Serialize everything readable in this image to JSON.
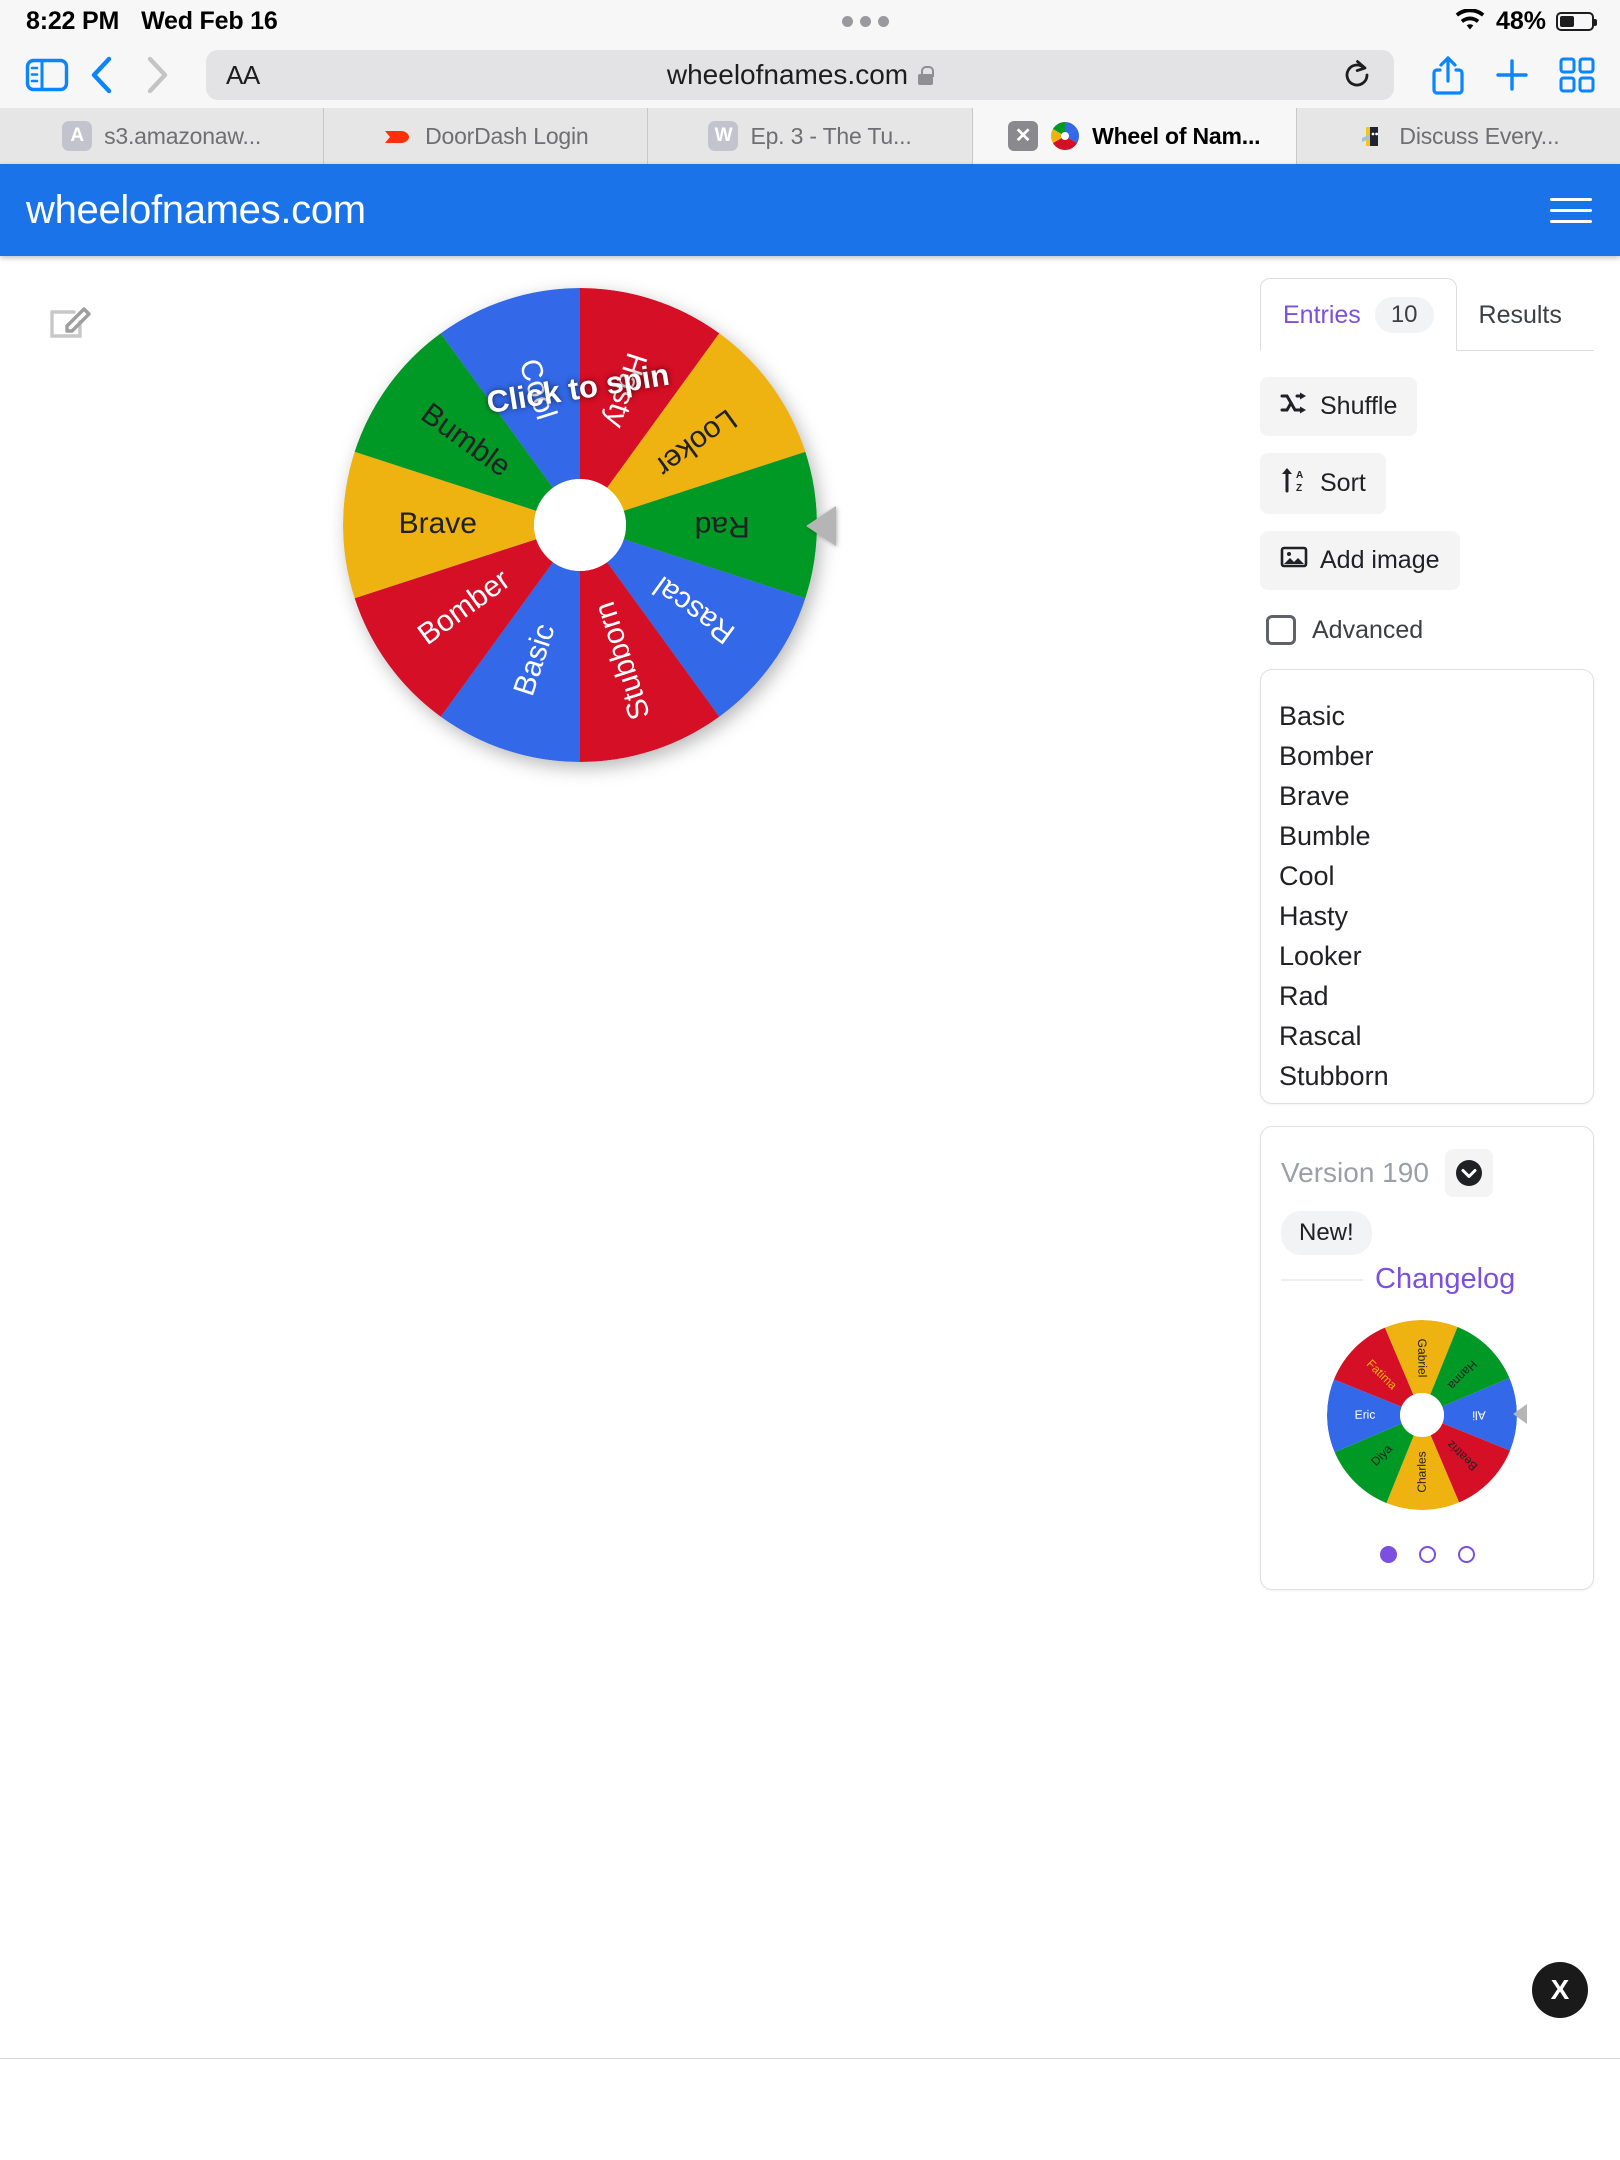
{
  "status_bar": {
    "time": "8:22 PM",
    "date": "Wed Feb 16",
    "battery_percent": "48%",
    "wifi_icon": "wifi-icon",
    "battery_icon": "battery-icon"
  },
  "browser": {
    "url": "wheelofnames.com",
    "text_size_label": "AA",
    "sidebar_icon": "sidebar-icon",
    "back_icon": "chevron-left-icon",
    "forward_icon": "chevron-right-icon",
    "reload_icon": "reload-icon",
    "share_icon": "share-icon",
    "new_tab_icon": "plus-icon",
    "tabs_overview_icon": "grid-icon",
    "tabs": [
      {
        "label": "s3.amazonaw...",
        "favicon_letter": "A",
        "active": false,
        "closable": false
      },
      {
        "label": "DoorDash Login",
        "favicon_letter": "",
        "active": false,
        "closable": false
      },
      {
        "label": "Ep. 3 - The Tu...",
        "favicon_letter": "W",
        "active": false,
        "closable": false
      },
      {
        "label": "Wheel of Nam...",
        "favicon_letter": "",
        "active": true,
        "closable": true
      },
      {
        "label": "Discuss Every...",
        "favicon_letter": "",
        "active": false,
        "closable": false
      }
    ]
  },
  "site": {
    "title": "wheelofnames.com",
    "header_color": "#1a73e8",
    "menu_icon": "hamburger-menu-icon"
  },
  "wheel": {
    "spin_label": "Click to spin",
    "edit_icon": "edit-pencil-icon",
    "pointer_icon": "pointer-triangle-icon",
    "segments": [
      {
        "label": "Rad",
        "color": "#009925",
        "text_color": "#202124"
      },
      {
        "label": "Rascal",
        "color": "#3369e8",
        "text_color": "#ffffff"
      },
      {
        "label": "Stubborn",
        "color": "#d50f25",
        "text_color": "#ffffff"
      },
      {
        "label": "Basic",
        "color": "#3369e8",
        "text_color": "#ffffff"
      },
      {
        "label": "Bomber",
        "color": "#d50f25",
        "text_color": "#ffffff"
      },
      {
        "label": "Brave",
        "color": "#eeb211",
        "text_color": "#202124"
      },
      {
        "label": "Bumble",
        "color": "#009925",
        "text_color": "#202124"
      },
      {
        "label": "Cool",
        "color": "#3369e8",
        "text_color": "#ffffff"
      },
      {
        "label": "Hasty",
        "color": "#d50f25",
        "text_color": "#ffffff"
      },
      {
        "label": "Looker",
        "color": "#eeb211",
        "text_color": "#202124"
      }
    ]
  },
  "panel": {
    "tabs": [
      {
        "label": "Entries",
        "count": "10",
        "active": true
      },
      {
        "label": "Results",
        "count": "",
        "active": false
      }
    ],
    "buttons": [
      {
        "label": "Shuffle",
        "icon": "shuffle-icon"
      },
      {
        "label": "Sort",
        "icon": "sort-az-icon"
      },
      {
        "label": "Add image",
        "icon": "image-icon"
      }
    ],
    "advanced_label": "Advanced",
    "advanced_checked": false,
    "entries": [
      "Basic",
      "Bomber",
      "Brave",
      "Bumble",
      "Cool",
      "Hasty",
      "Looker",
      "Rad",
      "Rascal",
      "Stubborn"
    ]
  },
  "version_card": {
    "version_label": "Version 190",
    "caret_icon": "chevron-down-circle-icon",
    "new_badge": "New!",
    "changelog_label": "Changelog",
    "carousel_dots": [
      true,
      false,
      false
    ],
    "mini_wheel": {
      "segments": [
        {
          "label": "Ali",
          "color": "#3369e8",
          "text_color": "#ffffff"
        },
        {
          "label": "Beatriz",
          "color": "#d50f25",
          "text_color": "#202124"
        },
        {
          "label": "Charles",
          "color": "#eeb211",
          "text_color": "#202124"
        },
        {
          "label": "Diya",
          "color": "#009925",
          "text_color": "#202124"
        },
        {
          "label": "Eric",
          "color": "#3369e8",
          "text_color": "#ffffff"
        },
        {
          "label": "Fatima",
          "color": "#d50f25",
          "text_color": "#eeb211"
        },
        {
          "label": "Gabriel",
          "color": "#eeb211",
          "text_color": "#202124"
        },
        {
          "label": "Hanna",
          "color": "#009925",
          "text_color": "#202124"
        }
      ]
    }
  },
  "bottom": {
    "badge_label": "X"
  }
}
